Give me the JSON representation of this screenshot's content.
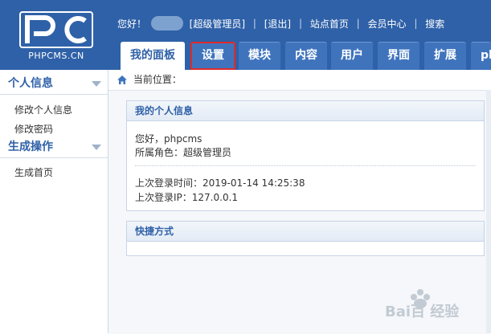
{
  "logo": {
    "mark": "PC",
    "subtitle": "PHPCMS.CN"
  },
  "topbar": {
    "greeting": "您好！",
    "role_link": "[超级管理员]",
    "logout_link": "[退出]",
    "links": [
      "站点首页",
      "会员中心",
      "搜索"
    ]
  },
  "tabs": [
    "我的面板",
    "设置",
    "模块",
    "内容",
    "用户",
    "界面",
    "扩展",
    "pl"
  ],
  "sidebar": {
    "sections": [
      {
        "title": "个人信息",
        "items": [
          "修改个人信息",
          "修改密码"
        ]
      },
      {
        "title": "生成操作",
        "items": [
          "生成首页"
        ]
      }
    ]
  },
  "breadcrumb": {
    "label": "当前位置："
  },
  "info_panel": {
    "title": "我的个人信息",
    "hello": "您好，phpcms",
    "role": "所属角色：超级管理员",
    "last_login_time": "上次登录时间：2019-01-14 14:25:38",
    "last_login_ip": "上次登录IP：127.0.0.1"
  },
  "shortcut_panel": {
    "title": "快捷方式"
  },
  "watermark": {
    "text": "Bai百 经验"
  },
  "colors": {
    "header": "#2f61a8",
    "tab": "#3f74bd",
    "highlight": "#e02a2a"
  }
}
